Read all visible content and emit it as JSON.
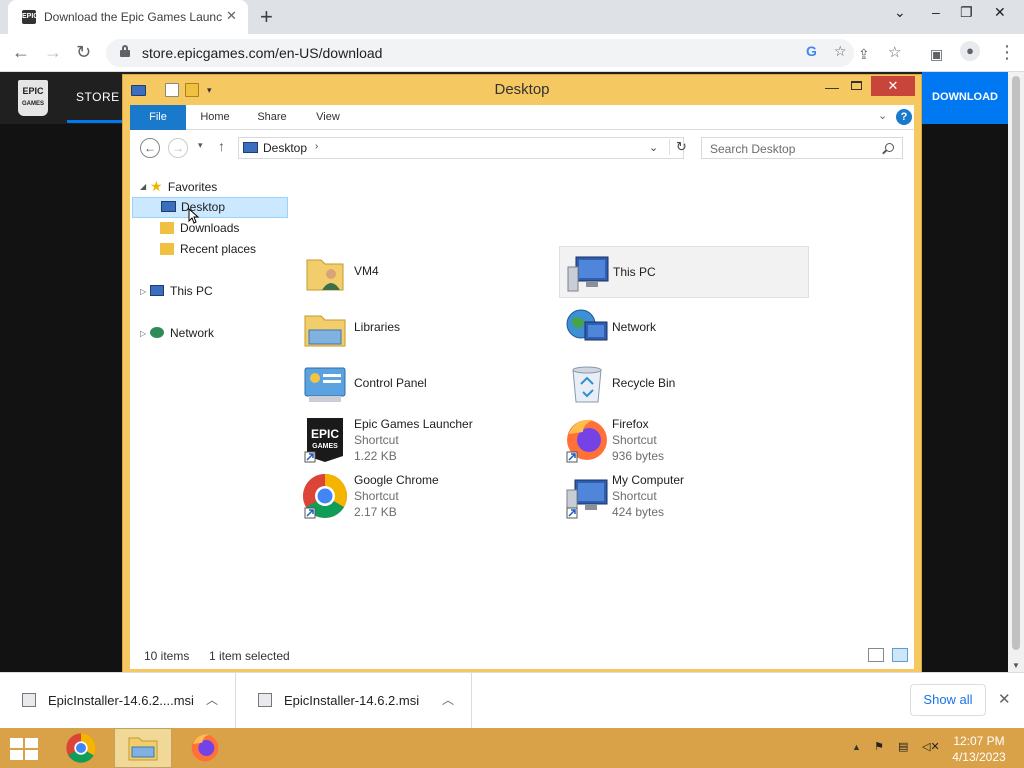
{
  "browser": {
    "tab_title": "Download the Epic Games Launcher",
    "tab_favicon": "EPIC",
    "new_tab_symbol": "+",
    "tab_close_symbol": "✕",
    "url": "store.epicgames.com/en-US/download",
    "google_glyph": "G",
    "star_glyph": "☆",
    "menu_glyph": "⋮"
  },
  "epic": {
    "logo_line1": "EPIC",
    "logo_line2": "GAMES",
    "store_label": "STORE",
    "download_label": "DOWNLOAD"
  },
  "explorer": {
    "title": "Desktop",
    "close_glyph": "✕",
    "min_glyph": "—",
    "ribbon_tabs": [
      {
        "label": "File"
      },
      {
        "label": "Home"
      },
      {
        "label": "Share"
      },
      {
        "label": "View"
      }
    ],
    "help_glyph": "?",
    "address_text": "Desktop",
    "search_placeholder": "Search Desktop",
    "nav_pane": {
      "favorites": "Favorites",
      "desktop": "Desktop",
      "downloads": "Downloads",
      "recent": "Recent places",
      "this_pc": "This PC",
      "network": "Network"
    },
    "items": [
      {
        "name": "VM4",
        "sub1": "",
        "sub2": "",
        "icon": "user-folder-icon"
      },
      {
        "name": "This PC",
        "sub1": "",
        "sub2": "",
        "icon": "computer-icon"
      },
      {
        "name": "Libraries",
        "sub1": "",
        "sub2": "",
        "icon": "libraries-icon"
      },
      {
        "name": "Network",
        "sub1": "",
        "sub2": "",
        "icon": "network-icon"
      },
      {
        "name": "Control Panel",
        "sub1": "",
        "sub2": "",
        "icon": "control-panel-icon"
      },
      {
        "name": "Recycle Bin",
        "sub1": "",
        "sub2": "",
        "icon": "recycle-bin-icon"
      },
      {
        "name": "Epic Games Launcher",
        "sub1": "Shortcut",
        "sub2": "1.22 KB",
        "icon": "epic-games-icon"
      },
      {
        "name": "Firefox",
        "sub1": "Shortcut",
        "sub2": "936 bytes",
        "icon": "firefox-icon"
      },
      {
        "name": "Google Chrome",
        "sub1": "Shortcut",
        "sub2": "2.17 KB",
        "icon": "chrome-icon"
      },
      {
        "name": "My Computer",
        "sub1": "Shortcut",
        "sub2": "424 bytes",
        "icon": "computer-shortcut-icon"
      }
    ],
    "status_count": "10 items",
    "status_selected": "1 item selected"
  },
  "downloads": {
    "items": [
      {
        "name": "EpicInstaller-14.6.2....msi"
      },
      {
        "name": "EpicInstaller-14.6.2.msi"
      }
    ],
    "show_all": "Show all"
  },
  "taskbar": {
    "time": "12:07 PM",
    "date": "4/13/2023",
    "tray_up": "▲"
  },
  "colors": {
    "explorer_frame": "#f5c862",
    "ribbon_file": "#1979ca",
    "epic_download": "#0078f2",
    "taskbar": "#d9a249"
  }
}
